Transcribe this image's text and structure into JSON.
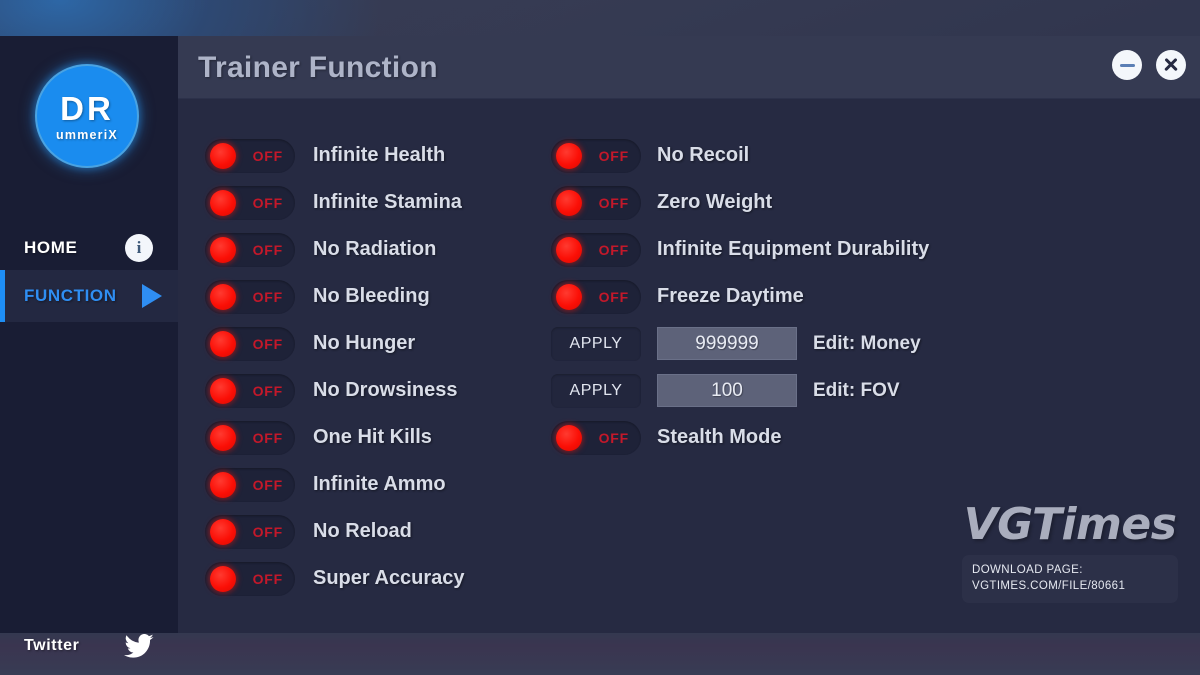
{
  "window": {
    "title": "Trainer Function",
    "controls": [
      {
        "name": "minimize-button",
        "label": "minimize-icon"
      },
      {
        "name": "close-button",
        "label": "close-icon"
      }
    ]
  },
  "sidebar": {
    "logo": {
      "main": "DR",
      "sub": "ummeriX"
    },
    "items": [
      {
        "label": "HOME",
        "icon": "info-icon"
      },
      {
        "label": "FUNCTION",
        "icon": "play-icon",
        "active": true
      }
    ],
    "footer": {
      "label": "Twitter",
      "icon": "twitter-icon"
    }
  },
  "options": {
    "state_off": "OFF",
    "apply_label": "APPLY",
    "left_column": [
      {
        "label": "Infinite Health",
        "state": "OFF"
      },
      {
        "label": "Infinite Stamina",
        "state": "OFF"
      },
      {
        "label": "No Radiation",
        "state": "OFF"
      },
      {
        "label": "No Bleeding",
        "state": "OFF"
      },
      {
        "label": "No Hunger",
        "state": "OFF"
      },
      {
        "label": "No Drowsiness",
        "state": "OFF"
      },
      {
        "label": "One Hit Kills",
        "state": "OFF"
      },
      {
        "label": "Infinite Ammo",
        "state": "OFF"
      },
      {
        "label": "No Reload",
        "state": "OFF"
      },
      {
        "label": "Super Accuracy",
        "state": "OFF"
      }
    ],
    "right_column": [
      {
        "type": "toggle",
        "label": "No Recoil",
        "state": "OFF"
      },
      {
        "type": "toggle",
        "label": "Zero Weight",
        "state": "OFF"
      },
      {
        "type": "toggle",
        "label": "Infinite Equipment Durability",
        "state": "OFF"
      },
      {
        "type": "toggle",
        "label": "Freeze Daytime",
        "state": "OFF"
      },
      {
        "type": "edit",
        "button": "APPLY",
        "value": "999999",
        "label": "Edit: Money"
      },
      {
        "type": "edit",
        "button": "APPLY",
        "value": "100",
        "label": "Edit: FOV"
      },
      {
        "type": "toggle",
        "label": "Stealth Mode",
        "state": "OFF"
      }
    ]
  },
  "watermark": {
    "logo": "VGTimes",
    "line1": "DOWNLOAD PAGE:",
    "line2": "VGTIMES.COM/FILE/80661"
  },
  "colors": {
    "accent_blue": "#1e8ef5",
    "toggle_red": "#fb0f06",
    "state_off_text": "#c4182a",
    "window_body": "#262a42",
    "sidebar": "#191d34",
    "titlebar": "#353a52"
  }
}
